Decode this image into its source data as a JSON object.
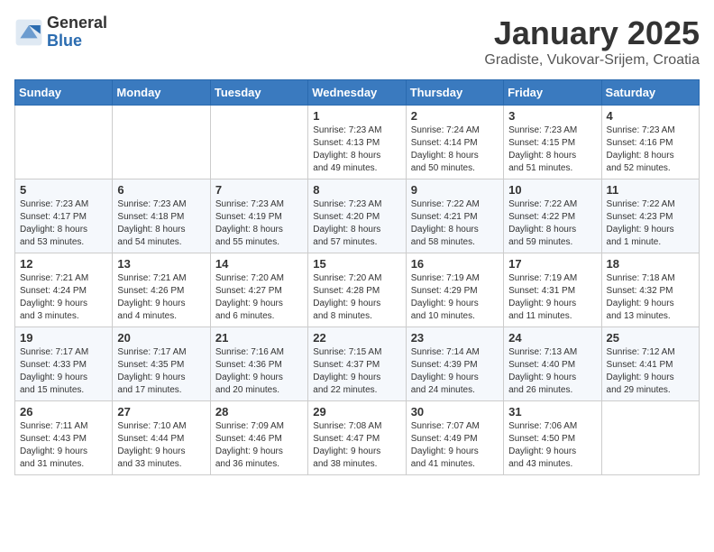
{
  "header": {
    "logo_general": "General",
    "logo_blue": "Blue",
    "month": "January 2025",
    "location": "Gradiste, Vukovar-Srijem, Croatia"
  },
  "weekdays": [
    "Sunday",
    "Monday",
    "Tuesday",
    "Wednesday",
    "Thursday",
    "Friday",
    "Saturday"
  ],
  "weeks": [
    [
      {
        "day": "",
        "info": ""
      },
      {
        "day": "",
        "info": ""
      },
      {
        "day": "",
        "info": ""
      },
      {
        "day": "1",
        "info": "Sunrise: 7:23 AM\nSunset: 4:13 PM\nDaylight: 8 hours\nand 49 minutes."
      },
      {
        "day": "2",
        "info": "Sunrise: 7:24 AM\nSunset: 4:14 PM\nDaylight: 8 hours\nand 50 minutes."
      },
      {
        "day": "3",
        "info": "Sunrise: 7:23 AM\nSunset: 4:15 PM\nDaylight: 8 hours\nand 51 minutes."
      },
      {
        "day": "4",
        "info": "Sunrise: 7:23 AM\nSunset: 4:16 PM\nDaylight: 8 hours\nand 52 minutes."
      }
    ],
    [
      {
        "day": "5",
        "info": "Sunrise: 7:23 AM\nSunset: 4:17 PM\nDaylight: 8 hours\nand 53 minutes."
      },
      {
        "day": "6",
        "info": "Sunrise: 7:23 AM\nSunset: 4:18 PM\nDaylight: 8 hours\nand 54 minutes."
      },
      {
        "day": "7",
        "info": "Sunrise: 7:23 AM\nSunset: 4:19 PM\nDaylight: 8 hours\nand 55 minutes."
      },
      {
        "day": "8",
        "info": "Sunrise: 7:23 AM\nSunset: 4:20 PM\nDaylight: 8 hours\nand 57 minutes."
      },
      {
        "day": "9",
        "info": "Sunrise: 7:22 AM\nSunset: 4:21 PM\nDaylight: 8 hours\nand 58 minutes."
      },
      {
        "day": "10",
        "info": "Sunrise: 7:22 AM\nSunset: 4:22 PM\nDaylight: 8 hours\nand 59 minutes."
      },
      {
        "day": "11",
        "info": "Sunrise: 7:22 AM\nSunset: 4:23 PM\nDaylight: 9 hours\nand 1 minute."
      }
    ],
    [
      {
        "day": "12",
        "info": "Sunrise: 7:21 AM\nSunset: 4:24 PM\nDaylight: 9 hours\nand 3 minutes."
      },
      {
        "day": "13",
        "info": "Sunrise: 7:21 AM\nSunset: 4:26 PM\nDaylight: 9 hours\nand 4 minutes."
      },
      {
        "day": "14",
        "info": "Sunrise: 7:20 AM\nSunset: 4:27 PM\nDaylight: 9 hours\nand 6 minutes."
      },
      {
        "day": "15",
        "info": "Sunrise: 7:20 AM\nSunset: 4:28 PM\nDaylight: 9 hours\nand 8 minutes."
      },
      {
        "day": "16",
        "info": "Sunrise: 7:19 AM\nSunset: 4:29 PM\nDaylight: 9 hours\nand 10 minutes."
      },
      {
        "day": "17",
        "info": "Sunrise: 7:19 AM\nSunset: 4:31 PM\nDaylight: 9 hours\nand 11 minutes."
      },
      {
        "day": "18",
        "info": "Sunrise: 7:18 AM\nSunset: 4:32 PM\nDaylight: 9 hours\nand 13 minutes."
      }
    ],
    [
      {
        "day": "19",
        "info": "Sunrise: 7:17 AM\nSunset: 4:33 PM\nDaylight: 9 hours\nand 15 minutes."
      },
      {
        "day": "20",
        "info": "Sunrise: 7:17 AM\nSunset: 4:35 PM\nDaylight: 9 hours\nand 17 minutes."
      },
      {
        "day": "21",
        "info": "Sunrise: 7:16 AM\nSunset: 4:36 PM\nDaylight: 9 hours\nand 20 minutes."
      },
      {
        "day": "22",
        "info": "Sunrise: 7:15 AM\nSunset: 4:37 PM\nDaylight: 9 hours\nand 22 minutes."
      },
      {
        "day": "23",
        "info": "Sunrise: 7:14 AM\nSunset: 4:39 PM\nDaylight: 9 hours\nand 24 minutes."
      },
      {
        "day": "24",
        "info": "Sunrise: 7:13 AM\nSunset: 4:40 PM\nDaylight: 9 hours\nand 26 minutes."
      },
      {
        "day": "25",
        "info": "Sunrise: 7:12 AM\nSunset: 4:41 PM\nDaylight: 9 hours\nand 29 minutes."
      }
    ],
    [
      {
        "day": "26",
        "info": "Sunrise: 7:11 AM\nSunset: 4:43 PM\nDaylight: 9 hours\nand 31 minutes."
      },
      {
        "day": "27",
        "info": "Sunrise: 7:10 AM\nSunset: 4:44 PM\nDaylight: 9 hours\nand 33 minutes."
      },
      {
        "day": "28",
        "info": "Sunrise: 7:09 AM\nSunset: 4:46 PM\nDaylight: 9 hours\nand 36 minutes."
      },
      {
        "day": "29",
        "info": "Sunrise: 7:08 AM\nSunset: 4:47 PM\nDaylight: 9 hours\nand 38 minutes."
      },
      {
        "day": "30",
        "info": "Sunrise: 7:07 AM\nSunset: 4:49 PM\nDaylight: 9 hours\nand 41 minutes."
      },
      {
        "day": "31",
        "info": "Sunrise: 7:06 AM\nSunset: 4:50 PM\nDaylight: 9 hours\nand 43 minutes."
      },
      {
        "day": "",
        "info": ""
      }
    ]
  ]
}
